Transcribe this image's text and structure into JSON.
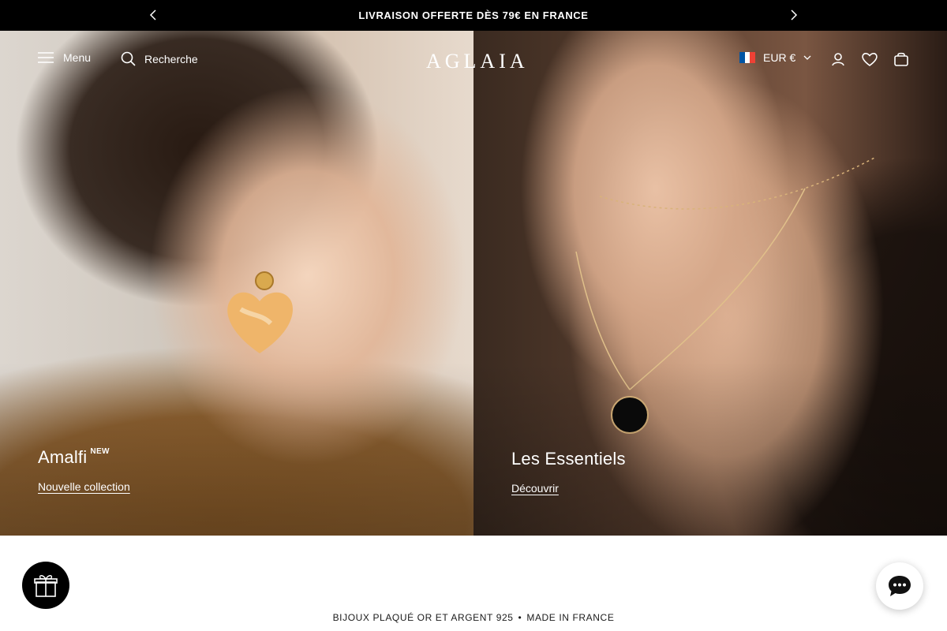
{
  "announcement": {
    "message": "LIVRAISON OFFERTE DÈS 79€ EN FRANCE",
    "prev_icon": "chevron-left-icon",
    "next_icon": "chevron-right-icon"
  },
  "header": {
    "menu_label": "Menu",
    "search_label": "Recherche",
    "logo": "AGLAIA",
    "currency_label": "EUR €",
    "flag_colors": [
      "#0055a4",
      "#ffffff",
      "#ef4135"
    ],
    "icons": [
      "menu-icon",
      "search-icon",
      "account-icon",
      "wishlist-heart-icon",
      "cart-bag-icon"
    ]
  },
  "hero": {
    "left": {
      "title": "Amalfi",
      "badge": "NEW",
      "link": "Nouvelle collection"
    },
    "right": {
      "title": "Les Essentiels",
      "link": "Découvrir"
    }
  },
  "footer_strip": {
    "tagline_part1": "BIJOUX PLAQUÉ OR ET ARGENT 925",
    "separator": "•",
    "tagline_part2": "MADE IN FRANCE"
  },
  "floating": {
    "gift_icon": "gift-icon",
    "chat_icon": "chat-bubble-icon"
  },
  "colors": {
    "announcement_bg": "#000000",
    "text_light": "#ffffff",
    "text_dark": "#1a1a1a"
  }
}
